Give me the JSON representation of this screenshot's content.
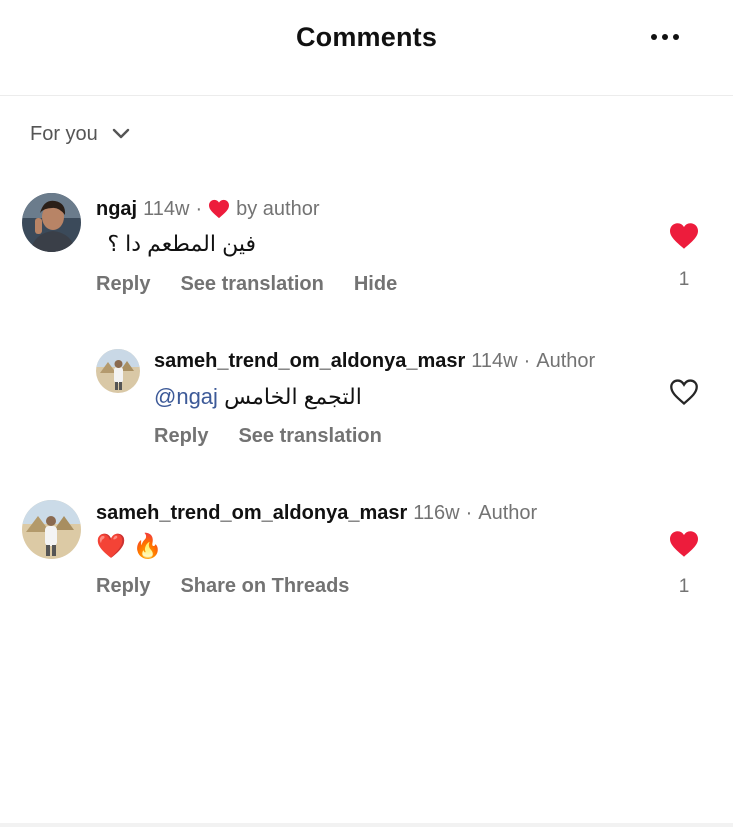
{
  "header": {
    "title": "Comments",
    "more_icon": "more-horizontal-icon"
  },
  "filter": {
    "label": "For you",
    "icon": "chevron-down-icon"
  },
  "comments": [
    {
      "username": "ngaj",
      "time": "114w",
      "separator": "·",
      "liked_by_author_label": "by author",
      "text": "فين المطعم دا ؟",
      "actions": [
        "Reply",
        "See translation",
        "Hide"
      ],
      "like_count": "1",
      "liked": true,
      "replies": [
        {
          "username": "sameh_trend_om_aldonya_masr",
          "time": "114w",
          "separator": "·",
          "author_tag": "Author",
          "mention": "@ngaj",
          "text": "التجمع الخامس",
          "actions": [
            "Reply",
            "See translation"
          ],
          "liked": false
        }
      ]
    },
    {
      "username": "sameh_trend_om_aldonya_masr",
      "time": "116w",
      "separator": "·",
      "author_tag": "Author",
      "text": "❤️ 🔥",
      "actions": [
        "Reply",
        "Share on Threads"
      ],
      "like_count": "1",
      "liked": true
    }
  ],
  "colors": {
    "like_red": "#ed1c3c",
    "muted": "#737373",
    "mention": "#3d5a98"
  }
}
